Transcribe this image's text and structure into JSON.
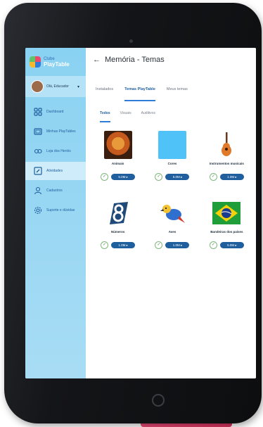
{
  "app": {
    "brand_small": "Clube",
    "brand_big": "PlayTable",
    "page_title": "Memória - Temas"
  },
  "user": {
    "name": "Olá, Educador"
  },
  "sidebar": {
    "items": [
      {
        "label": "Dashboard",
        "icon": "dashboard-icon",
        "active": false
      },
      {
        "label": "Minhas PlayTables",
        "icon": "tablet-icon",
        "active": false
      },
      {
        "label": "Loja dos Heróis",
        "icon": "store-icon",
        "active": false
      },
      {
        "label": "Atividades",
        "icon": "edit-icon",
        "active": true
      },
      {
        "label": "Cadastros",
        "icon": "person-icon",
        "active": false
      },
      {
        "label": "Suporte e dúvidas",
        "icon": "gear-icon",
        "active": false
      }
    ]
  },
  "tabs": [
    "Instalados",
    "Temas PlayTable",
    "Meus temas"
  ],
  "subtabs": [
    "Todos",
    "Visuais",
    "Auditivos"
  ],
  "themes": [
    {
      "label": "Animais",
      "button": "5.0M ▸"
    },
    {
      "label": "Cores",
      "button": "5.0M ▸"
    },
    {
      "label": "Instrumentos musicais",
      "button": "1.0M ▸"
    },
    {
      "label": "Números",
      "button": "1.0M ▸"
    },
    {
      "label": "Aves",
      "button": "1.0M ▸"
    },
    {
      "label": "Bandeiras dos países",
      "button": "5.0M ▸"
    }
  ],
  "colors": {
    "sidebar": "#8ad2f2",
    "accent": "#1f5f9e",
    "stand": "#e94a76"
  }
}
